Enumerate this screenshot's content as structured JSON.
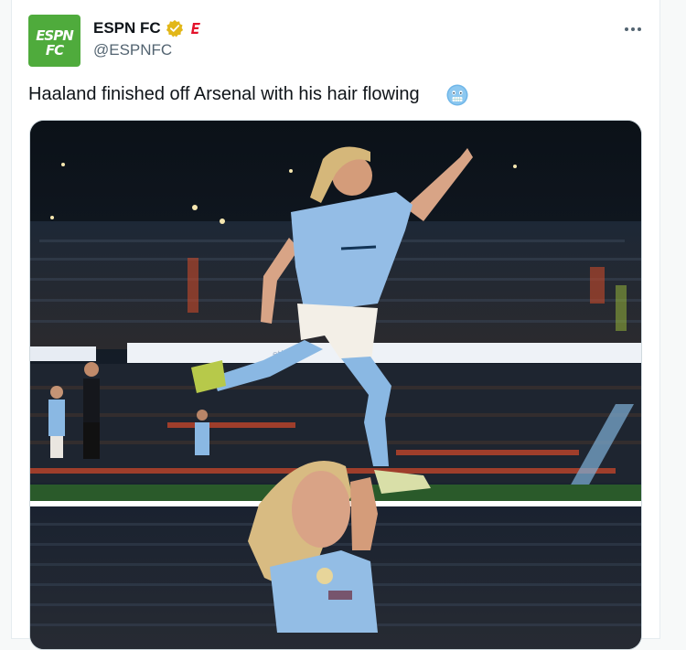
{
  "author": {
    "display_name": "ESPN FC",
    "handle": "@ESPNFC",
    "avatar_logo_line1": "ESPN",
    "avatar_logo_line2": "FC",
    "verified_badge": "gold-verified-icon",
    "affiliate_badge": "espn-e-icon",
    "avatar_color": "#4fab3c"
  },
  "tweet": {
    "text": "Haaland finished off Arsenal with his hair flowing",
    "emoji": "cold-face-emoji"
  },
  "media": {
    "photos": 2,
    "top_photo_icon": "player-celebration-photo",
    "bottom_photo_icon": "player-portrait-photo"
  },
  "colors": {
    "accent": "#1d9bf0",
    "secondary_text": "#536471",
    "espn_green": "#4fab3c",
    "verified_gold": "#e2b719"
  }
}
